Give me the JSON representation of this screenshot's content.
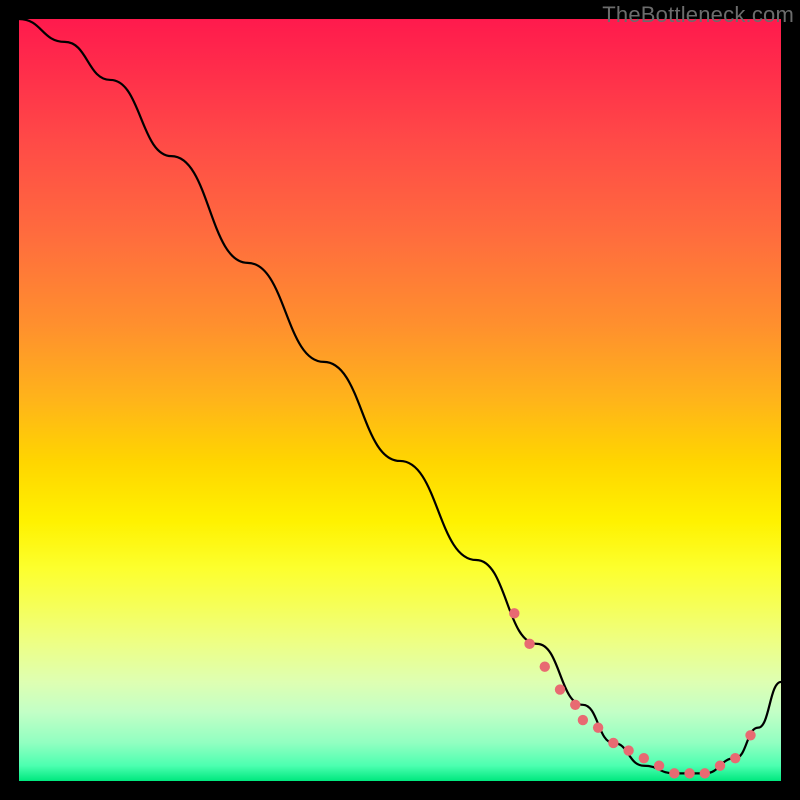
{
  "watermark": "TheBottleneck.com",
  "chart_data": {
    "type": "line",
    "title": "",
    "xlabel": "",
    "ylabel": "",
    "xlim": [
      0,
      100
    ],
    "ylim": [
      0,
      100
    ],
    "grid": false,
    "legend": "none",
    "series": [
      {
        "name": "bottleneck-curve",
        "x": [
          0,
          6,
          12,
          20,
          30,
          40,
          50,
          60,
          68,
          74,
          78,
          82,
          86,
          90,
          94,
          97,
          100
        ],
        "values": [
          100,
          97,
          92,
          82,
          68,
          55,
          42,
          29,
          18,
          10,
          5,
          2,
          1,
          1,
          3,
          7,
          13
        ]
      }
    ],
    "markers": {
      "name": "highlight-dots",
      "color": "#e86a72",
      "x": [
        65,
        67,
        69,
        71,
        73,
        74,
        76,
        78,
        80,
        82,
        84,
        86,
        88,
        90,
        92,
        94,
        96
      ],
      "values": [
        22,
        18,
        15,
        12,
        10,
        8,
        7,
        5,
        4,
        3,
        2,
        1,
        1,
        1,
        2,
        3,
        6
      ]
    },
    "colors": {
      "background_top": "#ff1a4d",
      "background_bottom": "#00e87e",
      "curve": "#000000",
      "marker": "#e86a72",
      "frame": "#000000"
    }
  }
}
